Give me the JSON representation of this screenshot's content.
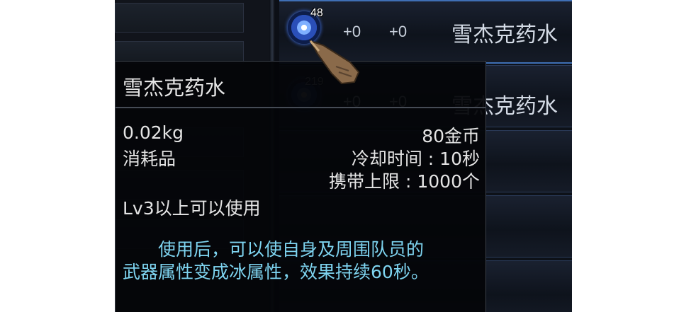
{
  "inventory": {
    "items": [
      {
        "count": "48",
        "stat1": "+0",
        "stat2": "+0",
        "name": "雪杰克药水"
      },
      {
        "count": "219",
        "stat1": "+0",
        "stat2": "+0",
        "name": "雪杰克药水"
      }
    ]
  },
  "tooltip": {
    "title": "雪杰克药水",
    "weight": "0.02kg",
    "price": "80金币",
    "type": "消耗品",
    "cooldown": "冷却时间 : 10秒",
    "carry_limit": "携带上限 : 1000个",
    "level_req": "Lv3以上可以使用",
    "description": "　　使用后，可以使自身及周围队员的武器属性变成冰属性，效果持续60秒。"
  },
  "colors": {
    "description": "#7ed4f0",
    "text": "#e4e4e4",
    "selected_border": "#3f6fb5"
  }
}
